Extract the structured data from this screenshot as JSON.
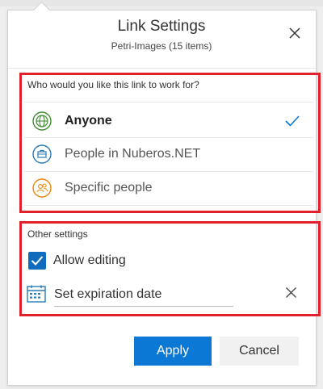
{
  "dialog": {
    "title": "Link Settings",
    "subtitle": "Petri-Images (15 items)",
    "close_icon": "close-icon"
  },
  "audience": {
    "question": "Who would you like this link to work for?",
    "options": [
      {
        "label": "Anyone",
        "icon": "globe-icon",
        "color": "#3e8e2f",
        "selected": true
      },
      {
        "label": "People in Nuberos.NET",
        "icon": "organization-briefcase-icon",
        "color": "#2a7ab8",
        "selected": false
      },
      {
        "label": "Specific people",
        "icon": "people-icon",
        "color": "#e8880c",
        "selected": false
      }
    ],
    "selected_check_icon": "checkmark-icon"
  },
  "other_settings": {
    "heading": "Other settings",
    "allow_editing": {
      "label": "Allow editing",
      "checked": true
    },
    "expiration": {
      "placeholder": "Set expiration date",
      "value": "",
      "icon": "calendar-icon",
      "clear_icon": "clear-icon"
    }
  },
  "actions": {
    "apply_label": "Apply",
    "cancel_label": "Cancel"
  },
  "colors": {
    "accent": "#0a78d4",
    "highlight_border": "#e0202b"
  }
}
